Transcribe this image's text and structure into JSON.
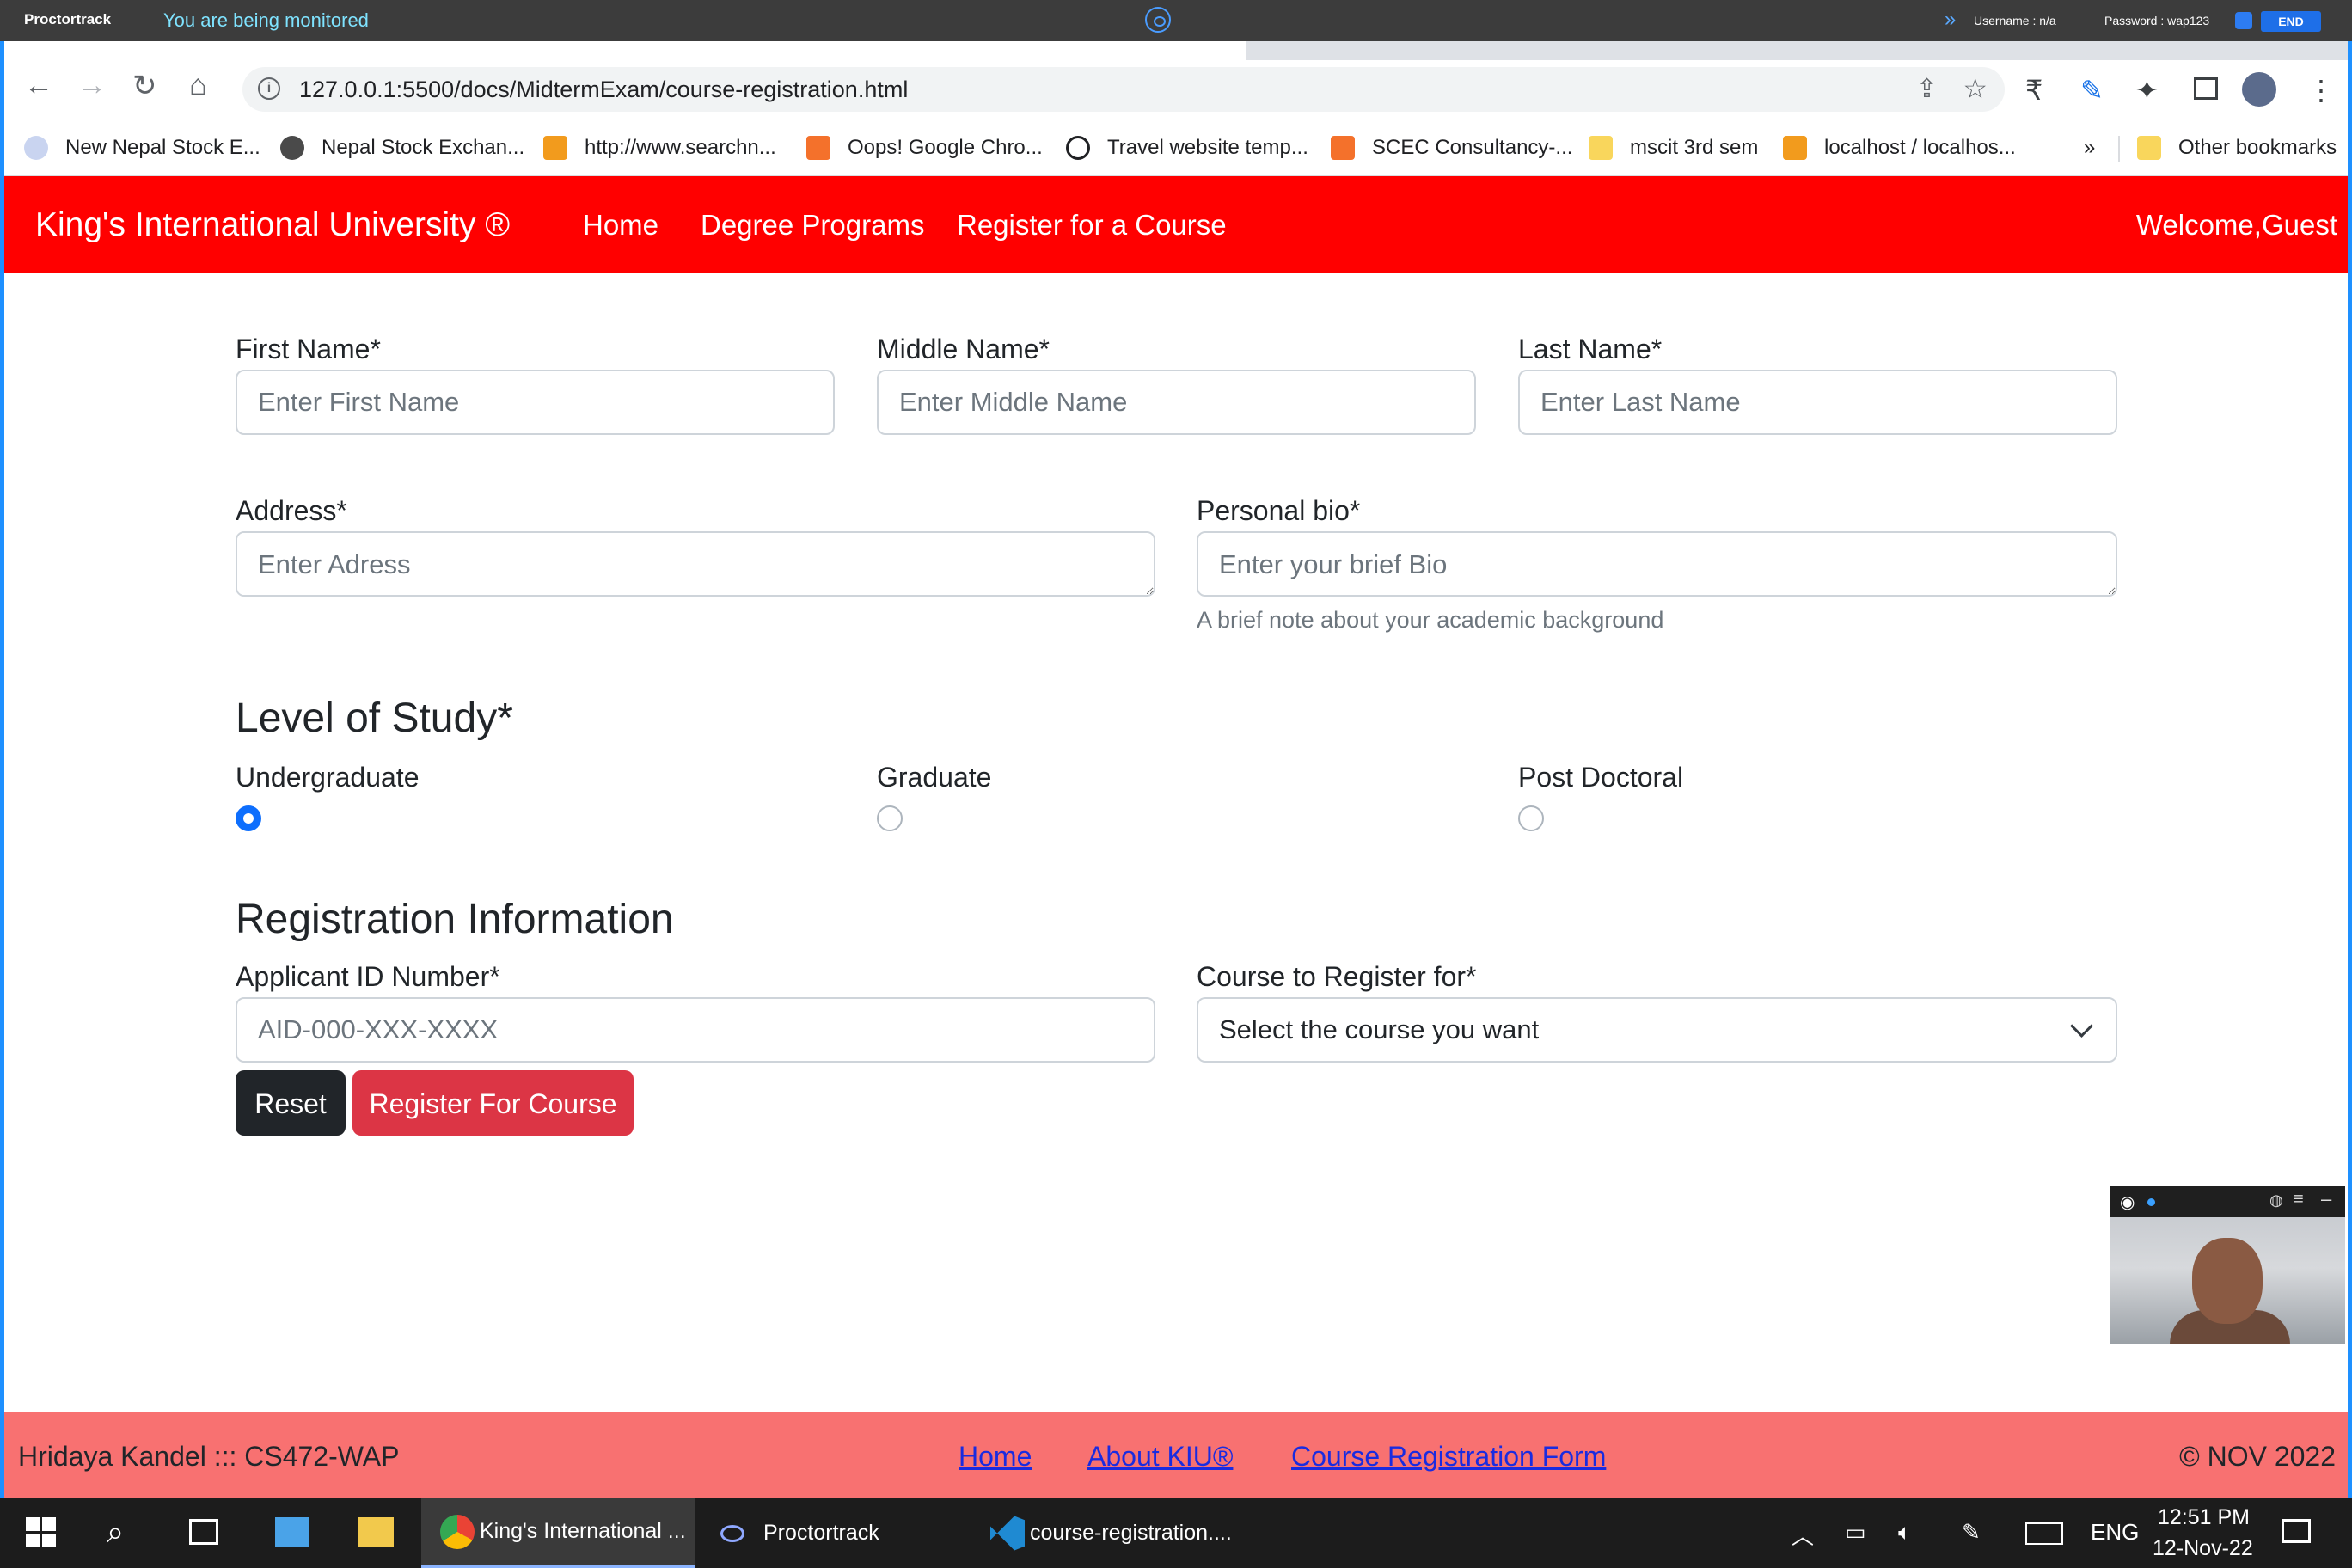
{
  "proctor": {
    "brand": "Proctortrack",
    "status": "You are being monitored",
    "username": "Username : n/a",
    "password": "Password : wap123",
    "end_label": "END"
  },
  "browser": {
    "url": "127.0.0.1:5500/docs/MidtermExam/course-registration.html",
    "bookmarks": [
      {
        "label": "New Nepal Stock E...",
        "icon": "globe-icon",
        "color": "#c9d4f0"
      },
      {
        "label": "Nepal Stock Exchan...",
        "icon": "globe-icon",
        "color": "#4a4a4a"
      },
      {
        "label": "http://www.searchn...",
        "icon": "pma-icon",
        "color": "#f29b1d"
      },
      {
        "label": "Oops! Google Chro...",
        "icon": "xampp-icon",
        "color": "#f4712b"
      },
      {
        "label": "Travel website temp...",
        "icon": "download-icon",
        "color": "#202124"
      },
      {
        "label": "SCEC Consultancy-...",
        "icon": "xampp-icon",
        "color": "#f4712b"
      },
      {
        "label": "mscit 3rd sem",
        "icon": "folder-icon",
        "color": "#f9d65c"
      },
      {
        "label": "localhost / localhos...",
        "icon": "pma-icon",
        "color": "#f29b1d"
      }
    ],
    "overflow_label": "»",
    "other_bookmarks": "Other bookmarks"
  },
  "navbar": {
    "brand": "King's International University ®",
    "links": [
      "Home",
      "Degree Programs",
      "Register for a Course"
    ],
    "welcome": "Welcome,Guest"
  },
  "form": {
    "first_name": {
      "label": "First Name*",
      "placeholder": "Enter First Name"
    },
    "middle_name": {
      "label": "Middle Name*",
      "placeholder": "Enter Middle Name"
    },
    "last_name": {
      "label": "Last Name*",
      "placeholder": "Enter Last Name"
    },
    "address": {
      "label": "Address*",
      "placeholder": "Enter Adress"
    },
    "bio": {
      "label": "Personal bio*",
      "placeholder": "Enter your brief Bio",
      "help": "A brief note about your academic background"
    },
    "level_heading": "Level of Study*",
    "levels": [
      {
        "label": "Undergraduate",
        "checked": true
      },
      {
        "label": "Graduate",
        "checked": false
      },
      {
        "label": "Post Doctoral",
        "checked": false
      }
    ],
    "registration_heading": "Registration Information",
    "applicant_id": {
      "label": "Applicant ID Number*",
      "placeholder": "AID-000-XXX-XXXX"
    },
    "course": {
      "label": "Course to Register for*",
      "selected": "Select the course you want"
    },
    "reset_label": "Reset",
    "submit_label": "Register For Course"
  },
  "footer": {
    "author": "Hridaya Kandel ::: CS472-WAP",
    "links": [
      "Home",
      "About KIU®",
      "Course Registration Form"
    ],
    "copyright": "© NOV 2022"
  },
  "taskbar": {
    "items": [
      "King's International ...",
      "Proctortrack",
      "course-registration...."
    ],
    "lang": "ENG",
    "time": "12:51 PM",
    "date": "12-Nov-22"
  },
  "colors": {
    "navbar": "#ff0000",
    "footer": "#f87171",
    "primary": "#0d6efd",
    "reset_button": "#212529",
    "submit_button": "#dc3545"
  }
}
